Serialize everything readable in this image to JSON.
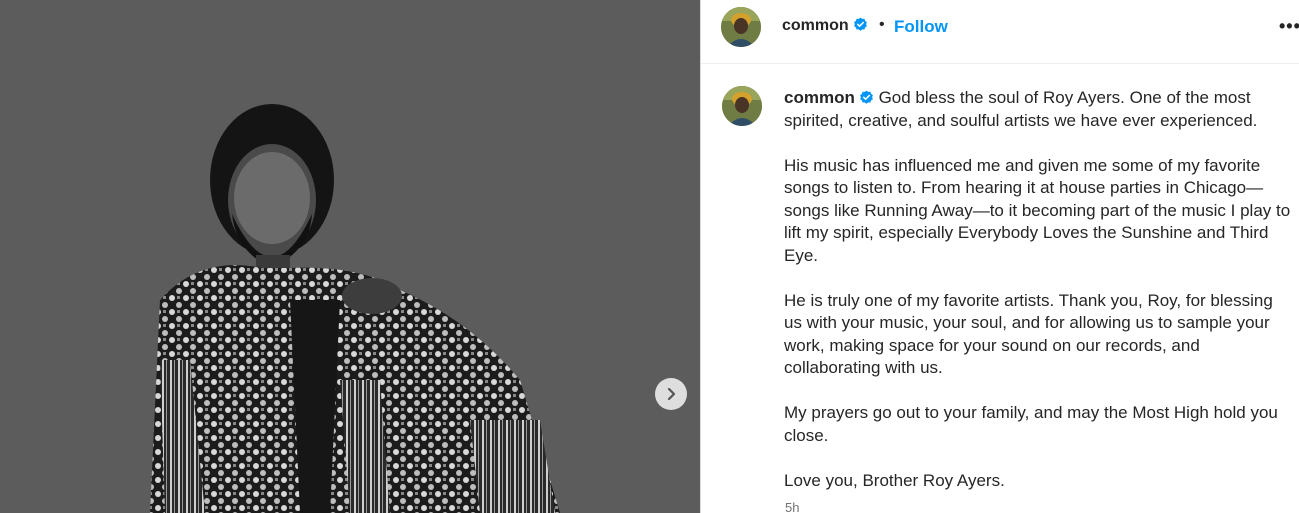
{
  "post": {
    "username": "common",
    "separator": "•",
    "follow_label": "Follow",
    "more_label": "•••",
    "caption_paragraphs": [
      "God bless the soul of Roy Ayers. One of the most spirited, creative, and soulful artists we have ever experienced.",
      "His music has influenced me and given me some of my favorite songs to listen to. From hearing it at house parties in Chicago—songs like Running Away—to it becoming part of the music I play to lift my spirit, especially Everybody Loves the Sunshine and Third Eye.",
      "He is truly one of my favorite artists. Thank you, Roy, for blessing us with your music, your soul, and for allowing us to sample your work, making space for your sound on our records, and collaborating with us.",
      "My prayers go out to your family, and may the Most High hold you close.",
      "Love you, Brother Roy Ayers."
    ],
    "timestamp": "5h"
  },
  "icons": {
    "verified": "verified-badge-icon",
    "next": "chevron-right-icon",
    "more": "more-options-icon"
  },
  "colors": {
    "link": "#0095f6",
    "verified": "#0095f6",
    "media_bg": "#5c5c5c"
  }
}
